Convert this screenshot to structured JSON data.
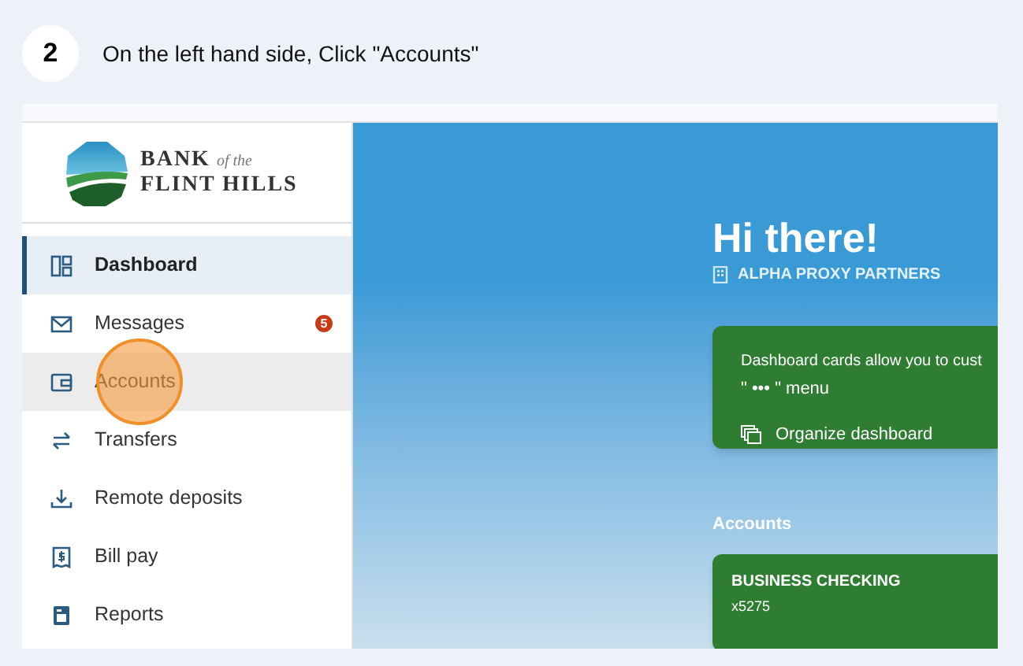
{
  "step": {
    "number": "2",
    "instruction": "On the left hand side, Click \"Accounts\""
  },
  "sidebar": {
    "logo": {
      "bank": "BANK",
      "of_the": "of the",
      "name": "FLINT HILLS"
    },
    "items": [
      {
        "label": "Dashboard",
        "selected": true,
        "clicked": false
      },
      {
        "label": "Messages",
        "selected": false,
        "clicked": false,
        "badge": "5"
      },
      {
        "label": "Accounts",
        "selected": false,
        "clicked": true
      },
      {
        "label": "Transfers",
        "selected": false,
        "clicked": false
      },
      {
        "label": "Remote deposits",
        "selected": false,
        "clicked": false
      },
      {
        "label": "Bill pay",
        "selected": false,
        "clicked": false
      },
      {
        "label": "Reports",
        "selected": false,
        "clicked": false
      }
    ]
  },
  "main": {
    "greeting": "Hi there!",
    "organization": "ALPHA PROXY PARTNERS",
    "info_card": {
      "text": "Dashboard cards allow you to cust",
      "text_2": "\" ••• \" menu",
      "action": "Organize dashboard"
    },
    "accounts_heading": "Accounts",
    "accounts": [
      {
        "name": "BUSINESS CHECKING",
        "number": "x5275"
      }
    ]
  }
}
